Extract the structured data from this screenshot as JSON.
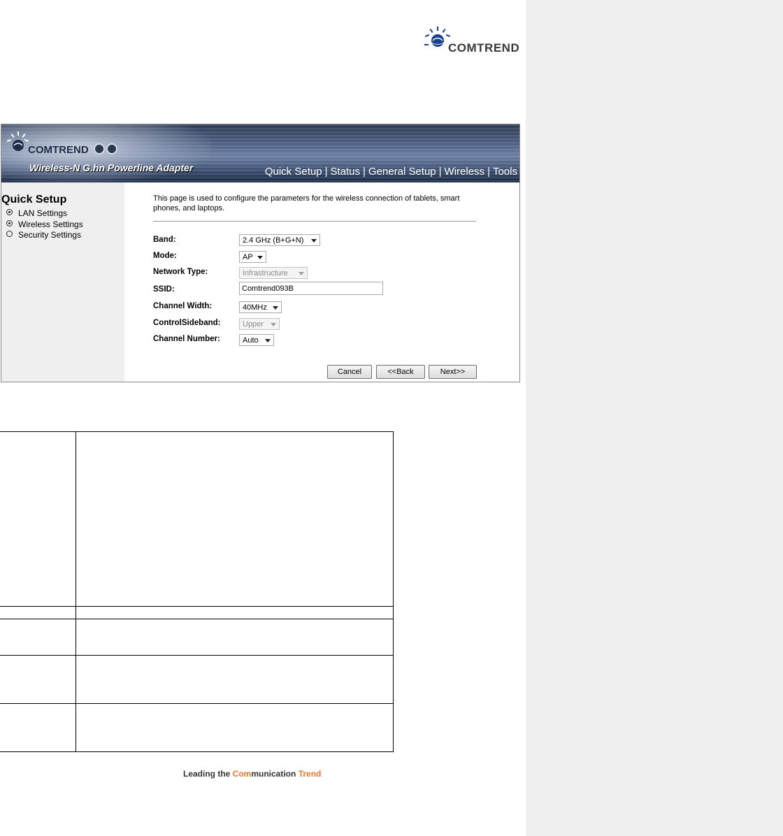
{
  "brand": {
    "logo_text": "COMTREND"
  },
  "banner": {
    "logo_text": "COMTREND",
    "product_title": "Wireless-N G.hn Powerline Adapter",
    "nav": [
      "Quick Setup",
      "Status",
      "General Setup",
      "Wireless",
      "Tools"
    ],
    "nav_separator": "|"
  },
  "sidebar": {
    "title": "Quick Setup",
    "items": [
      {
        "label": "LAN Settings",
        "selected": true
      },
      {
        "label": "Wireless Settings",
        "selected": true
      },
      {
        "label": "Security Settings",
        "selected": false
      }
    ]
  },
  "content": {
    "intro": "This page is used to configure the parameters for the wireless connection of tablets, smart phones, and laptops.",
    "fields": {
      "band": {
        "label": "Band:",
        "value": "2.4 GHz (B+G+N)"
      },
      "mode": {
        "label": "Mode:",
        "value": "AP"
      },
      "network_type": {
        "label": "Network Type:",
        "value": "Infrastructure"
      },
      "ssid": {
        "label": "SSID:",
        "value": "Comtrend093B"
      },
      "channel_width": {
        "label": "Channel Width:",
        "value": "40MHz"
      },
      "control_sideband": {
        "label": "ControlSideband:",
        "value": "Upper"
      },
      "channel_number": {
        "label": "Channel Number:",
        "value": "Auto"
      }
    },
    "buttons": {
      "cancel": "Cancel",
      "back": "<<Back",
      "next": "Next>>"
    }
  },
  "footer": {
    "slogan_part1": "Leading the ",
    "slogan_part2": "Com",
    "slogan_part3": "munication ",
    "slogan_part4": "Trend"
  },
  "colors": {
    "slogan_accent": "#e8762b",
    "side_panel": "#efefef"
  }
}
